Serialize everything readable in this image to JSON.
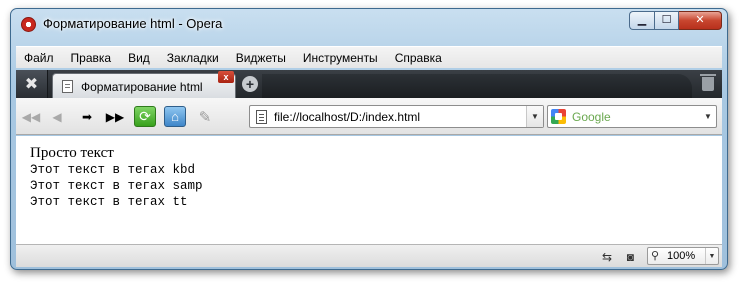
{
  "window": {
    "title": "Форматирование html - Opera",
    "controls": {
      "minimize": "▁",
      "maximize": "☐",
      "close": "✕"
    }
  },
  "menu": [
    "Файл",
    "Правка",
    "Вид",
    "Закладки",
    "Виджеты",
    "Инструменты",
    "Справка"
  ],
  "tab": {
    "label": "Форматирование html",
    "close": "x",
    "new_tab": "+"
  },
  "navigation": {
    "back_fast": "◀◀",
    "back": "◀",
    "forward": "➡",
    "forward_fast": "▶▶",
    "reload": "⟳",
    "home": "⌂",
    "wand": "✎"
  },
  "address": {
    "value": "file://localhost/D:/index.html",
    "dropdown": "▼"
  },
  "search": {
    "placeholder": "Google",
    "dropdown": "▼"
  },
  "content": {
    "plain_text": "Просто текст",
    "kbd_text": "Этот текст в тегах kbd",
    "samp_text": "Этот текст в тегах samp",
    "tt_text": "Этот текст в тегах tt"
  },
  "status": {
    "zoom": "100%",
    "zoom_dropdown": "▼"
  },
  "icons": {
    "tools": "wrench-icon",
    "trash": "trash-icon",
    "page": "page-icon",
    "google": "google-icon",
    "zoom": "magnifier-icon"
  },
  "colors": {
    "accent": "#c8281e",
    "tabbar": "#24282c",
    "chrome": "#a9c9e3"
  }
}
